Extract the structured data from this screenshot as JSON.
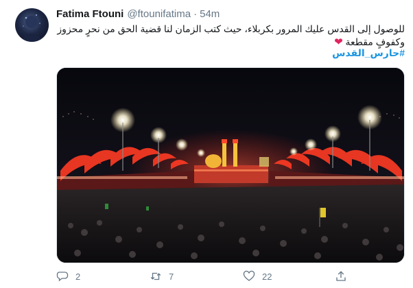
{
  "author": {
    "name": "Fatima Ftouni",
    "handle": "@ftounifatima",
    "separator": "·",
    "time": "54m"
  },
  "tweet": {
    "text": "للوصول إلى القدس عليك المرور بكربلاء، حيث كتب الزمان لنا قضية الحق من نحرٍ محزوز وكفوفٍ مقطعة",
    "emoji": "❤",
    "hashtag": "#حارس_القدس"
  },
  "icons": {
    "reply": "reply-icon",
    "retweet": "retweet-icon",
    "like": "like-icon",
    "share": "share-icon"
  },
  "stats": {
    "replies": "2",
    "retweets": "7",
    "likes": "22"
  },
  "colors": {
    "link": "#1b95e0",
    "secondary_text": "#657786",
    "heart": "#e0245e"
  }
}
